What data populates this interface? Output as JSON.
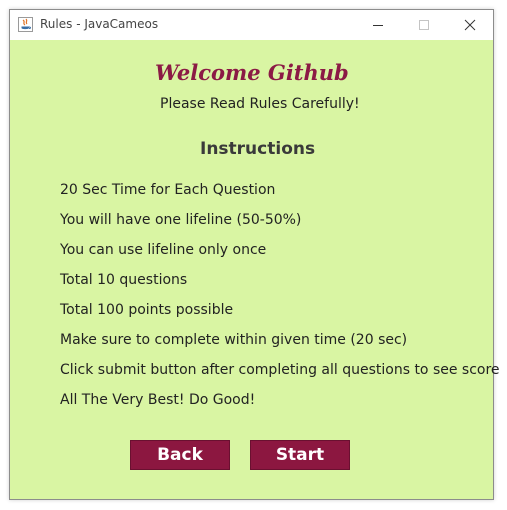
{
  "window": {
    "title": "Rules - JavaCameos"
  },
  "content": {
    "welcome": "Welcome Github",
    "subtitle": "Please Read Rules Carefully!",
    "heading": "Instructions",
    "rules": [
      "20 Sec Time for Each Question",
      "You will have one lifeline (50-50%)",
      "You can use lifeline only once",
      "Total 10 questions",
      "Total 100 points possible",
      "Make sure to complete within given time (20 sec)",
      "Click submit button after completing all questions to see score",
      "All The Very Best! Do Good!"
    ]
  },
  "buttons": {
    "back": "Back",
    "start": "Start"
  },
  "colors": {
    "background": "#d9f5a3",
    "accent": "#8c1740",
    "welcome_text": "#8b1a45"
  },
  "icons": {
    "app": "java-icon",
    "minimize": "minimize-icon",
    "maximize": "maximize-icon",
    "close": "close-icon"
  }
}
